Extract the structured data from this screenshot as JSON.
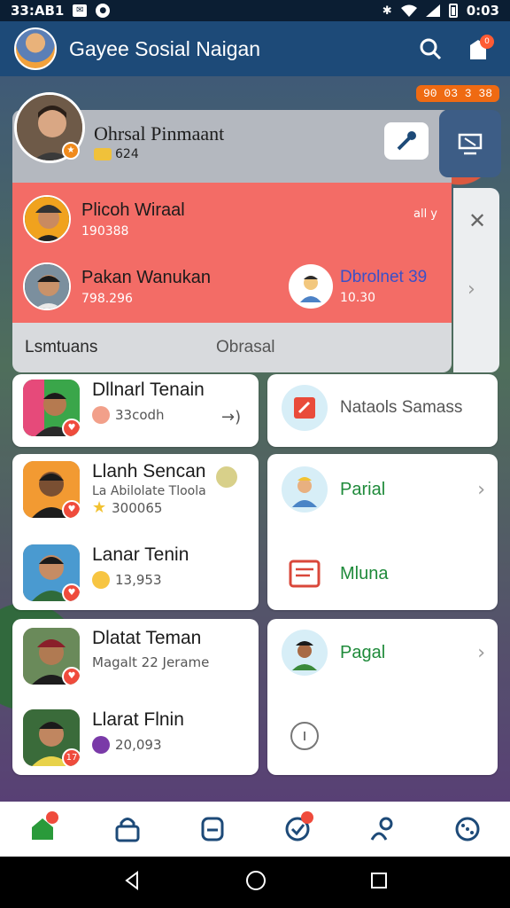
{
  "status_bar": {
    "left_text": "33:AB1",
    "time": "0:03"
  },
  "app_bar": {
    "title": "Gayee Sosial Naigan"
  },
  "notifications": {
    "count": "0"
  },
  "top_badge": "90 03 3 38",
  "profile": {
    "name": "Ohrsal Pinmaant",
    "sub": "624"
  },
  "popup": {
    "row1": {
      "name": "Plicoh Wiraal",
      "num": "190388",
      "meta": "all y"
    },
    "row2": {
      "name": "Pakan Wanukan",
      "num": "798.296"
    },
    "friend": {
      "name": "Dbrolnet 39",
      "num": "10.30"
    },
    "tabs": [
      "Lsmtuans",
      "Obrasal"
    ]
  },
  "friends": [
    {
      "name": "Dllnarl Tenain",
      "sub": "33codh",
      "badge": "♥"
    },
    {
      "name": "Llanh Sencan",
      "sub": "La Abilolate Tloola",
      "sub2": "300065",
      "badge": "♥"
    },
    {
      "name": "Lanar Tenin",
      "sub": "13,953",
      "badge": "♥"
    },
    {
      "name": "Dlatat Teman",
      "sub": "Magalt 22 Jerame",
      "badge": "♥"
    },
    {
      "name": "Llarat Flnin",
      "sub": "20,093",
      "badge": "17"
    }
  ],
  "groups": [
    {
      "label": "Nataols Samass"
    },
    {
      "label": "Parial"
    },
    {
      "label": "Mluna"
    },
    {
      "label": "Pagal"
    }
  ],
  "colors": {
    "app_bar": "#1d4a78",
    "popup": "#f36c66",
    "accent_green": "#1e8a3a",
    "badge_red": "#ef4b3c"
  }
}
